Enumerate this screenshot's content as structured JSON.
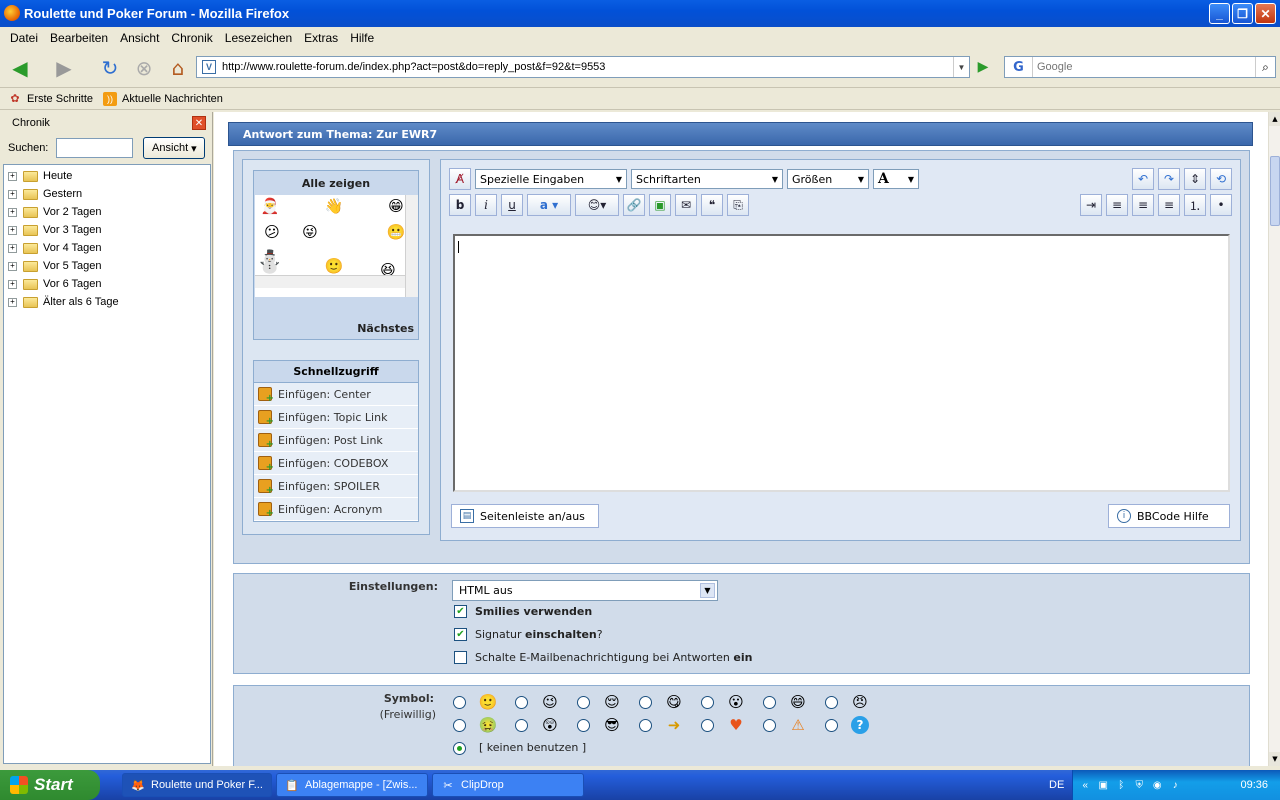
{
  "window": {
    "title": "Roulette und Poker Forum - Mozilla Firefox"
  },
  "menu": [
    "Datei",
    "Bearbeiten",
    "Ansicht",
    "Chronik",
    "Lesezeichen",
    "Extras",
    "Hilfe"
  ],
  "nav": {
    "url": "http://www.roulette-forum.de/index.php?act=post&do=reply_post&f=92&t=9553",
    "search_placeholder": "Google"
  },
  "bookmarks": [
    "Erste Schritte",
    "Aktuelle Nachrichten"
  ],
  "sidebar": {
    "title": "Chronik",
    "search_label": "Suchen:",
    "view_button": "Ansicht",
    "items": [
      "Heute",
      "Gestern",
      "Vor 2 Tagen",
      "Vor 3 Tagen",
      "Vor 4 Tagen",
      "Vor 5 Tagen",
      "Vor 6 Tagen",
      "Älter als 6 Tage"
    ]
  },
  "form": {
    "heading": "Antwort zum Thema: Zur EWR7",
    "smilies": {
      "title": "Alle zeigen",
      "next": "Nächstes"
    },
    "quick": {
      "title": "Schnellzugriff",
      "items": [
        "Einfügen: Center",
        "Einfügen: Topic Link",
        "Einfügen: Post Link",
        "Einfügen: CODEBOX",
        "Einfügen: SPOILER",
        "Einfügen: Acronym"
      ]
    },
    "toolbar": {
      "special": "Spezielle Eingaben",
      "fonts": "Schriftarten",
      "sizes": "Größen",
      "color": "A"
    },
    "toggle_sidebar": "Seitenleiste an/aus",
    "bbcode_help": "BBCode Hilfe",
    "settings": {
      "label": "Einstellungen:",
      "html_option": "HTML aus",
      "smilies": "Smilies verwenden",
      "signature_pre": "Signatur ",
      "signature_bold": "einschalten",
      "signature_post": "?",
      "notify_pre": "Schalte E-Mailbenachrichtigung bei Antworten ",
      "notify_bold": "ein"
    },
    "symbol": {
      "label": "Symbol:",
      "sublabel": "(Freiwillig)",
      "none": "[ keinen benutzen ]"
    }
  },
  "taskbar": {
    "start": "Start",
    "tasks": [
      "Roulette und Poker F...",
      "Ablagemappe - [Zwis...",
      "ClipDrop"
    ],
    "lang": "DE",
    "time": "09:36"
  },
  "colors": {
    "accent": "#3a67ab",
    "panel": "#d1dcea"
  }
}
